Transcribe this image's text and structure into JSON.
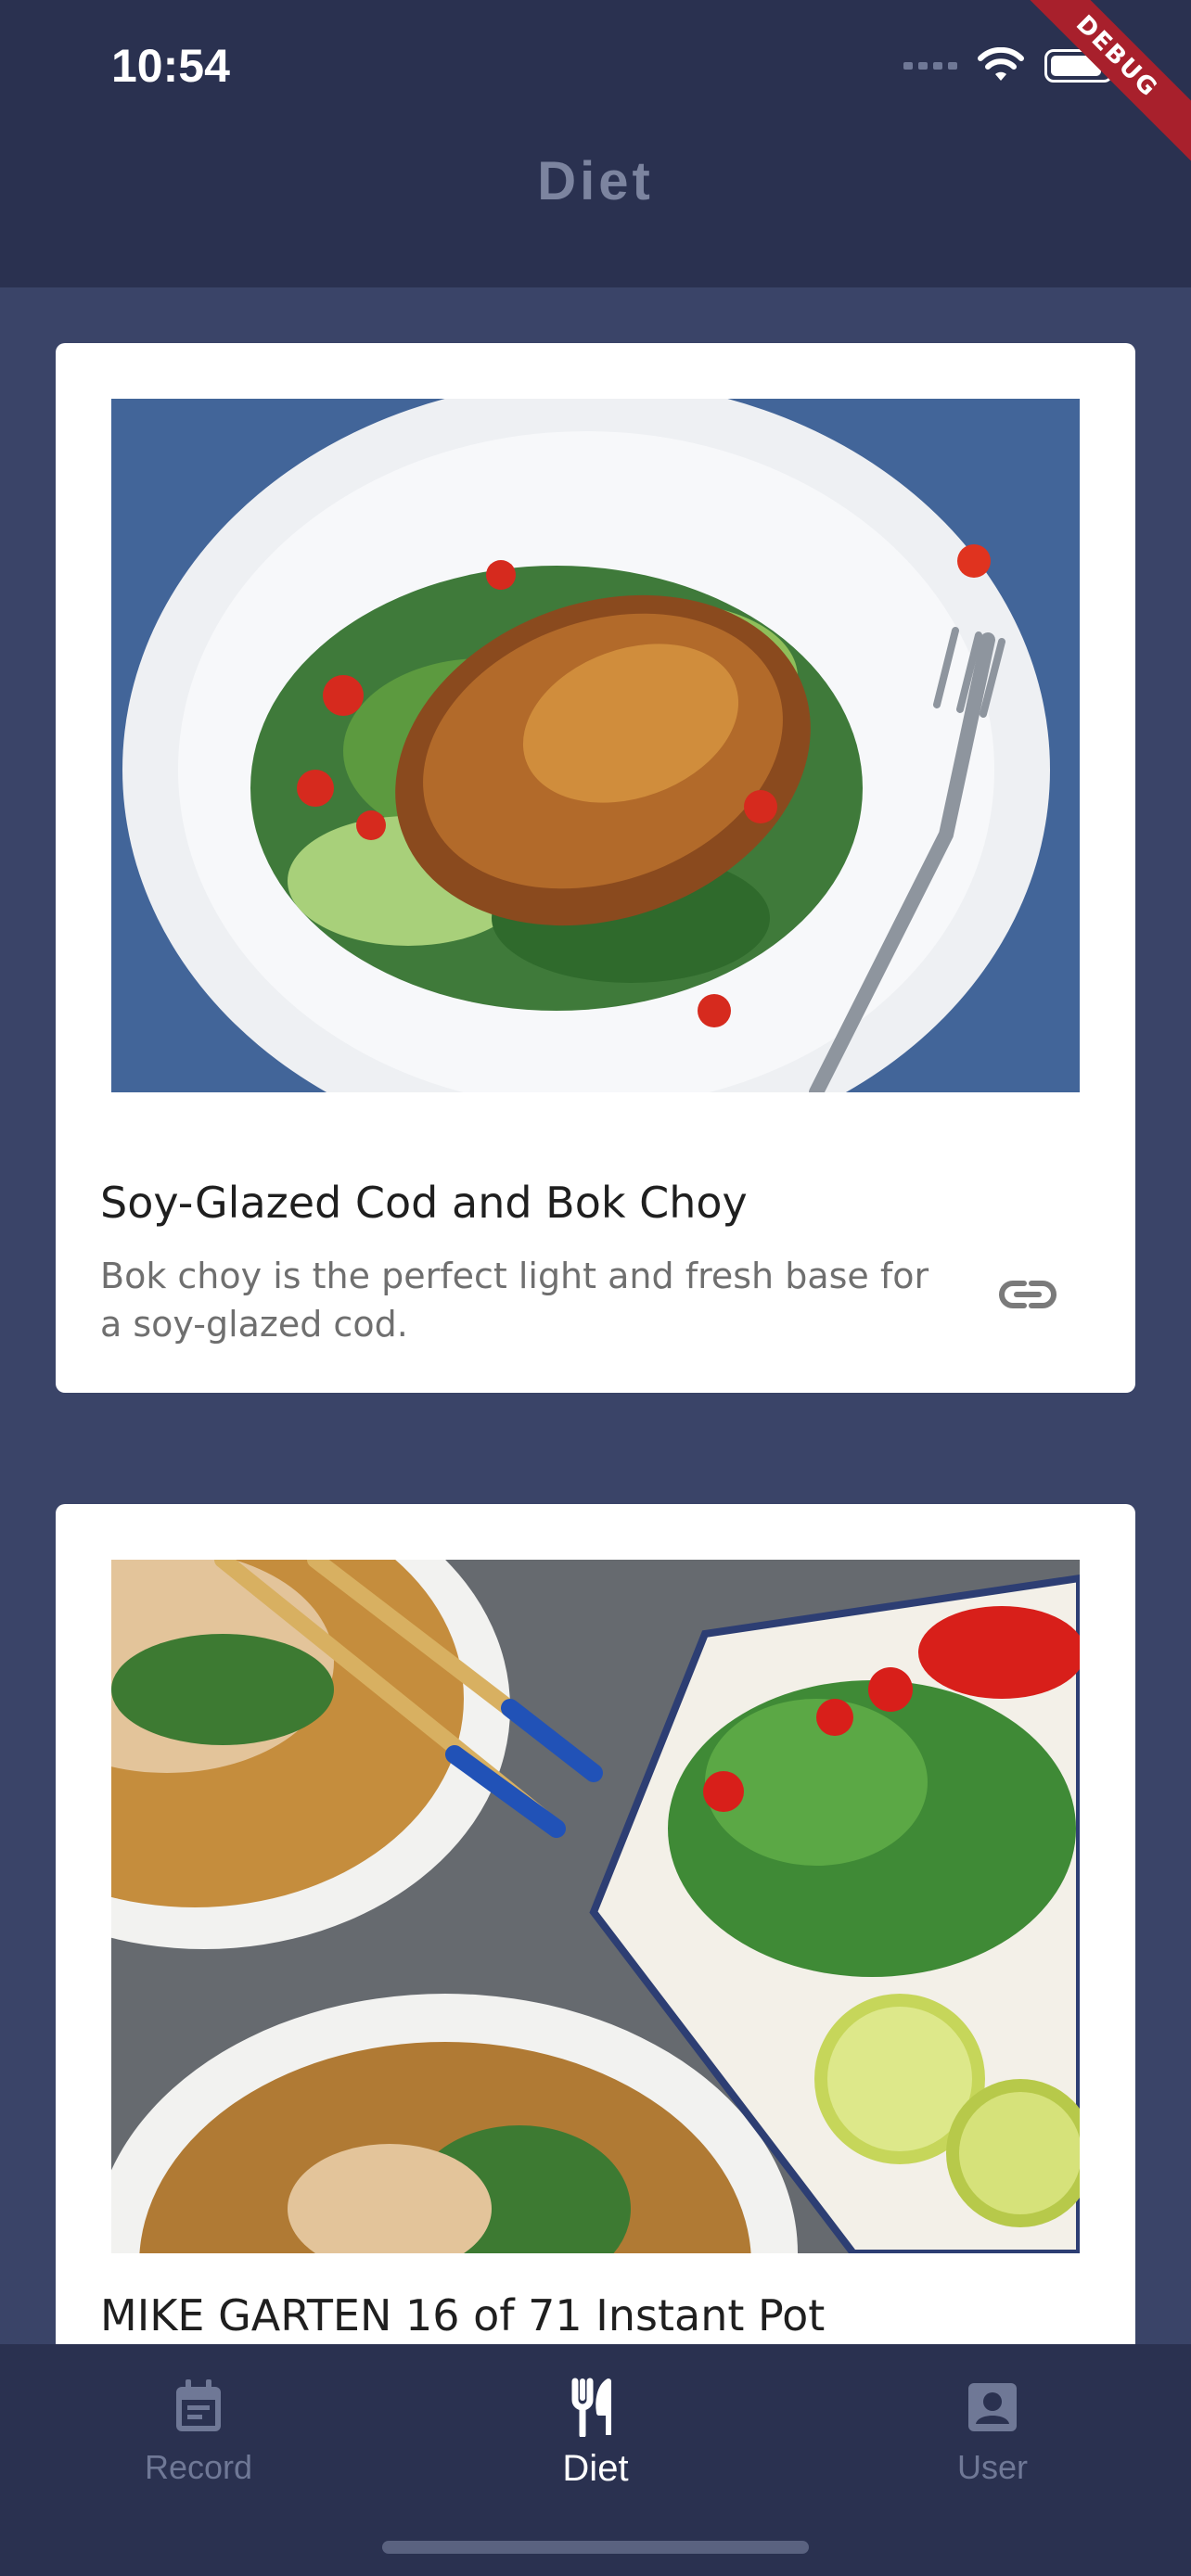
{
  "status_bar": {
    "time": "10:54",
    "signal_icon": "signal-dots-icon",
    "wifi_icon": "wifi-icon",
    "battery_icon": "battery-icon",
    "battery_level": 0.9
  },
  "debug_banner": "DEBUG",
  "app_bar": {
    "title": "Diet"
  },
  "cards": [
    {
      "title": "Soy-Glazed Cod and Bok Choy",
      "description": "Bok choy is the perfect light and fresh base for a soy-glazed cod.",
      "link_icon": "link-icon",
      "image": "glazed cod on bok choy salad with white plate and fork"
    },
    {
      "title": "MIKE GARTEN 16 of 71 Instant Pot",
      "image": "bowls of pho with herbs, chopsticks, limes and chili"
    }
  ],
  "bottom_nav": {
    "items": [
      {
        "label": "Record",
        "icon": "calendar-icon",
        "active": false
      },
      {
        "label": "Diet",
        "icon": "utensils-icon",
        "active": true
      },
      {
        "label": "User",
        "icon": "user-icon",
        "active": false
      }
    ]
  },
  "colors": {
    "background": "#3a4468",
    "bars": "#2a3150",
    "active": "#ffffff",
    "inactive": "#6f7896",
    "debug": "#a8202c"
  }
}
